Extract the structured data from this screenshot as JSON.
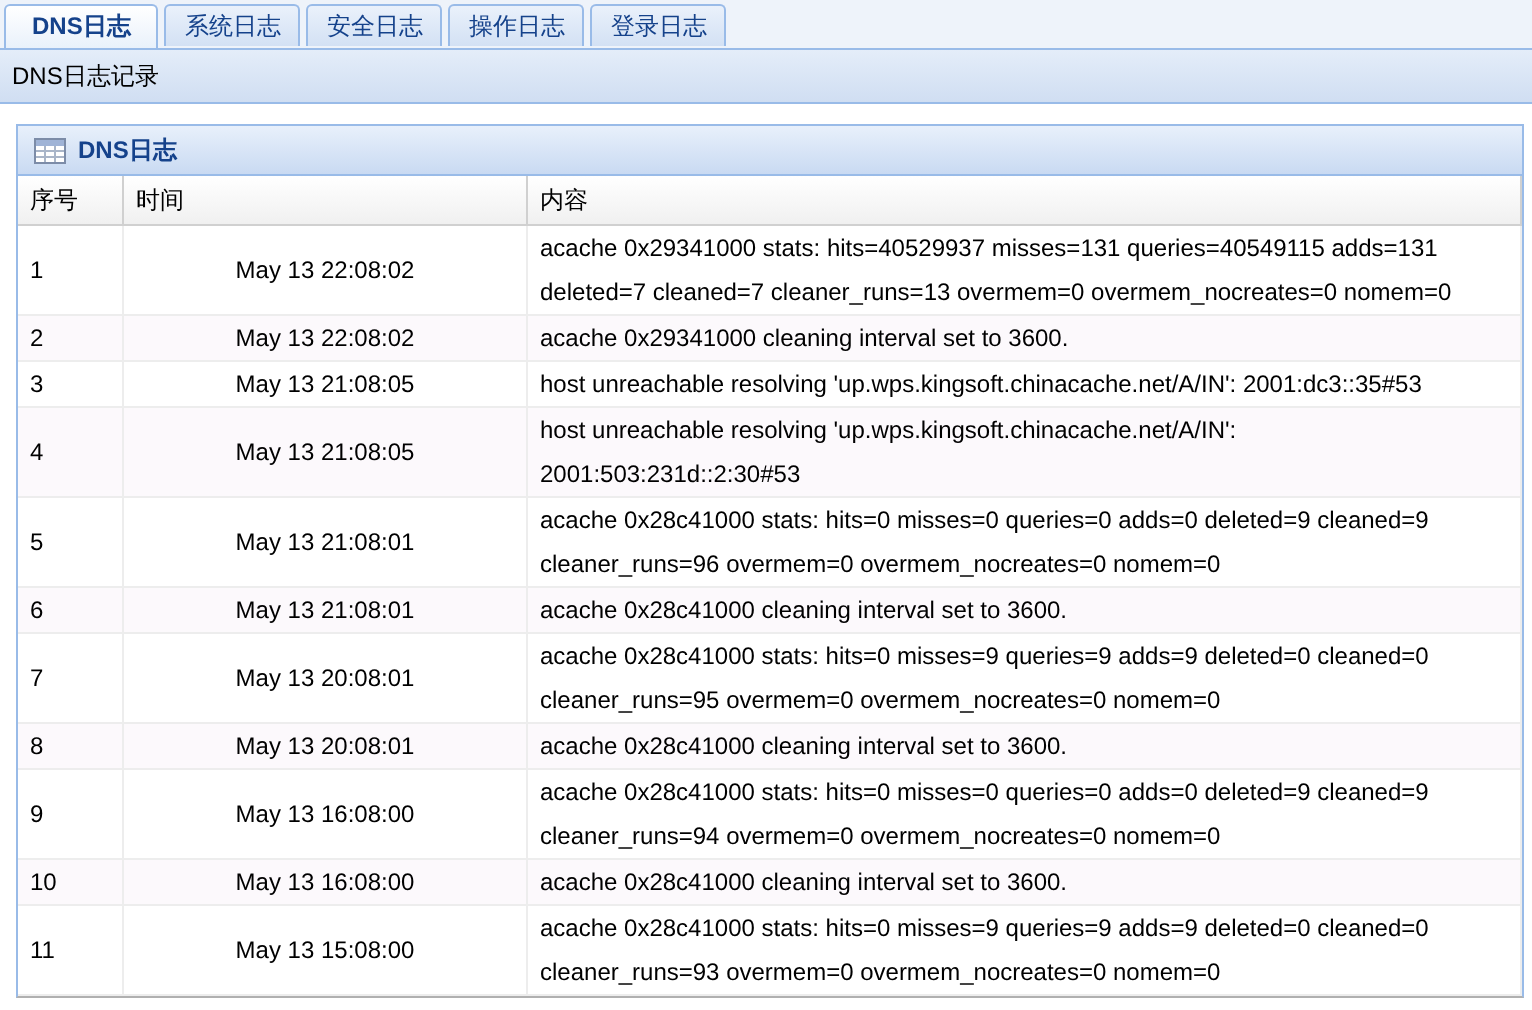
{
  "tabs": [
    {
      "label": "DNS日志",
      "selected": true
    },
    {
      "label": "系统日志",
      "selected": false
    },
    {
      "label": "安全日志",
      "selected": false
    },
    {
      "label": "操作日志",
      "selected": false
    },
    {
      "label": "登录日志",
      "selected": false
    }
  ],
  "subtitle": "DNS日志记录",
  "panel": {
    "title": "DNS日志"
  },
  "table": {
    "columns": [
      "序号",
      "时间",
      "内容"
    ],
    "rows": [
      {
        "index": "1",
        "time": "May 13 22:08:02",
        "content": [
          "acache 0x29341000 stats: hits=40529937 misses=131 queries=40549115 adds=131",
          "deleted=7 cleaned=7 cleaner_runs=13 overmem=0 overmem_nocreates=0 nomem=0"
        ]
      },
      {
        "index": "2",
        "time": "May 13 22:08:02",
        "content": [
          "acache 0x29341000 cleaning interval set to 3600."
        ]
      },
      {
        "index": "3",
        "time": "May 13 21:08:05",
        "content": [
          "host unreachable resolving 'up.wps.kingsoft.chinacache.net/A/IN': 2001:dc3::35#53"
        ]
      },
      {
        "index": "4",
        "time": "May 13 21:08:05",
        "content": [
          "host unreachable resolving 'up.wps.kingsoft.chinacache.net/A/IN':",
          "2001:503:231d::2:30#53"
        ]
      },
      {
        "index": "5",
        "time": "May 13 21:08:01",
        "content": [
          "acache 0x28c41000 stats: hits=0 misses=0 queries=0 adds=0 deleted=9 cleaned=9",
          "cleaner_runs=96 overmem=0 overmem_nocreates=0 nomem=0"
        ]
      },
      {
        "index": "6",
        "time": "May 13 21:08:01",
        "content": [
          "acache 0x28c41000 cleaning interval set to 3600."
        ]
      },
      {
        "index": "7",
        "time": "May 13 20:08:01",
        "content": [
          "acache 0x28c41000 stats: hits=0 misses=9 queries=9 adds=9 deleted=0 cleaned=0",
          "cleaner_runs=95 overmem=0 overmem_nocreates=0 nomem=0"
        ]
      },
      {
        "index": "8",
        "time": "May 13 20:08:01",
        "content": [
          "acache 0x28c41000 cleaning interval set to 3600."
        ]
      },
      {
        "index": "9",
        "time": "May 13 16:08:00",
        "content": [
          "acache 0x28c41000 stats: hits=0 misses=0 queries=0 adds=0 deleted=9 cleaned=9",
          "cleaner_runs=94 overmem=0 overmem_nocreates=0 nomem=0"
        ]
      },
      {
        "index": "10",
        "time": "May 13 16:08:00",
        "content": [
          "acache 0x28c41000 cleaning interval set to 3600."
        ]
      },
      {
        "index": "11",
        "time": "May 13 15:08:00",
        "content": [
          "acache 0x28c41000 stats: hits=0 misses=9 queries=9 adds=9 deleted=0 cleaned=0",
          "cleaner_runs=93 overmem=0 overmem_nocreates=0 nomem=0"
        ]
      }
    ]
  }
}
